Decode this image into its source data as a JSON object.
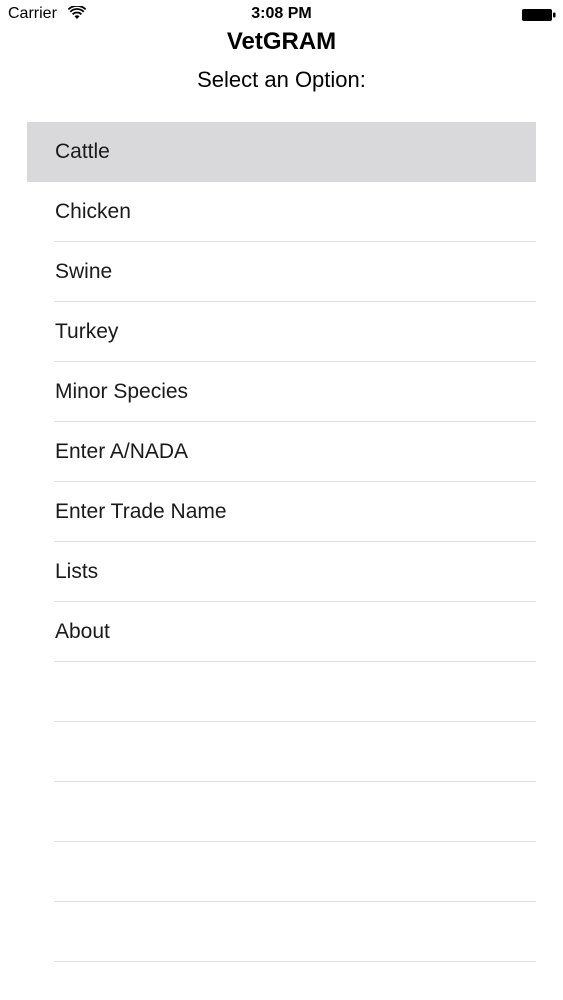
{
  "status_bar": {
    "carrier": "Carrier",
    "time": "3:08 PM",
    "wifi_icon": "wifi-icon",
    "battery_icon": "battery-icon"
  },
  "header": {
    "title": "VetGRAM",
    "subtitle": "Select an Option:"
  },
  "menu": {
    "selected_index": 0,
    "selected_color": "#d9d9dc",
    "items": [
      {
        "label": "Cattle"
      },
      {
        "label": "Chicken"
      },
      {
        "label": "Swine"
      },
      {
        "label": "Turkey"
      },
      {
        "label": "Minor Species"
      },
      {
        "label": "Enter A/NADA"
      },
      {
        "label": "Enter Trade Name"
      },
      {
        "label": "Lists"
      },
      {
        "label": "About"
      }
    ]
  }
}
